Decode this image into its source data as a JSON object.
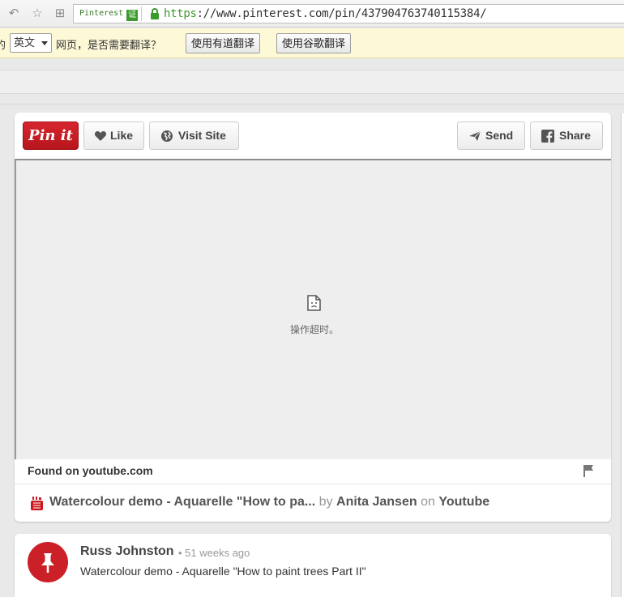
{
  "browser": {
    "site_tag": "Pinterest",
    "cert_badge": "证",
    "url_scheme": "https",
    "url_rest": "://www.pinterest.com/pin/437904763740115384/"
  },
  "translate_bar": {
    "cut_char": "的",
    "language": "英文",
    "prompt": "网页，是否需要翻译？",
    "youdao_button": "使用有道翻译",
    "google_button": "使用谷歌翻译"
  },
  "pin": {
    "pinit_label": "Pin it",
    "like_label": "Like",
    "visit_label": "Visit Site",
    "send_label": "Send",
    "share_label": "Share",
    "media_error": "操作超时。",
    "found_on": "Found on youtube.com",
    "title": "Watercolour demo - Aquarelle \"How to pa...",
    "by_word": "by",
    "author": "Anita Jansen",
    "on_word": "on",
    "source": "Youtube"
  },
  "comment": {
    "name": "Russ Johnston",
    "time": "• 51 weeks ago",
    "text": "Watercolour demo - Aquarelle \"How to paint trees Part II\""
  },
  "colors": {
    "pinterest_red": "#cb2027",
    "secure_green": "#3c9a2c",
    "translate_bar_bg": "#fdf9d7"
  }
}
